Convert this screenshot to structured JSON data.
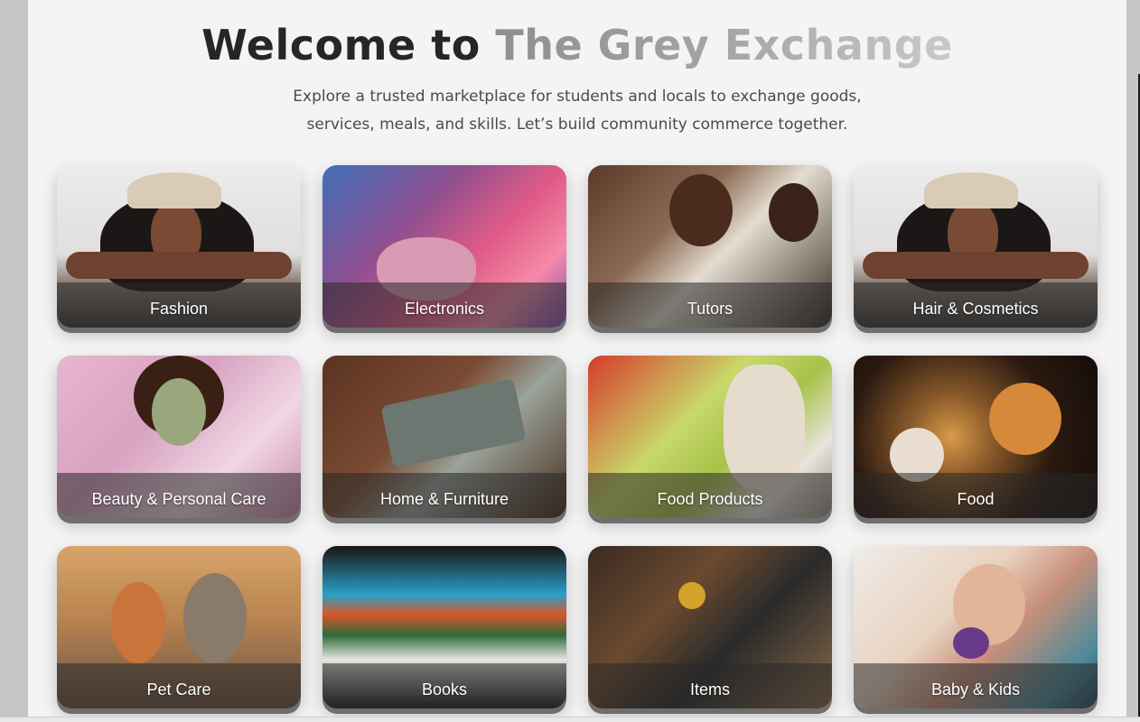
{
  "header": {
    "title_part1": "Welcome to",
    "title_part2": "The Grey Exchange",
    "subtitle": "Explore a trusted marketplace for students and locals to exchange goods, services, meals, and skills. Let’s build community commerce together."
  },
  "categories": [
    {
      "label": "Fashion"
    },
    {
      "label": "Electronics"
    },
    {
      "label": "Tutors"
    },
    {
      "label": "Hair & Cosmetics"
    },
    {
      "label": "Beauty & Personal Care"
    },
    {
      "label": "Home & Furniture"
    },
    {
      "label": "Food Products"
    },
    {
      "label": "Food"
    },
    {
      "label": "Pet Care"
    },
    {
      "label": "Books"
    },
    {
      "label": "Items"
    },
    {
      "label": "Baby & Kids"
    }
  ],
  "colors": {
    "page_background": "#f4f4f4",
    "title_dark": "#262626",
    "title_grey": "#a5a5a5",
    "card_label": "#ffffff"
  }
}
